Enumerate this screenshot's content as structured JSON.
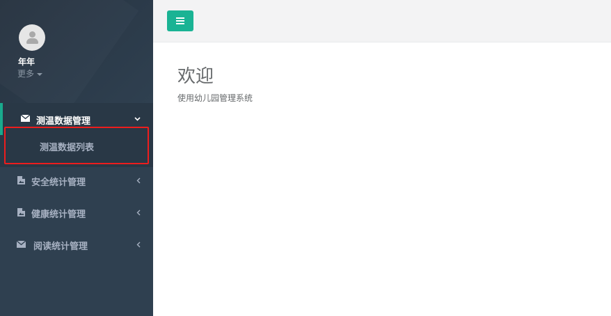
{
  "user": {
    "name": "年年",
    "more": "更多"
  },
  "nav": [
    {
      "label": "测温数据管理",
      "icon": "envelope-icon",
      "active": true,
      "expanded": true
    },
    {
      "label": "安全统计管理",
      "icon": "file-image-icon",
      "active": false,
      "expanded": false
    },
    {
      "label": "健康统计管理",
      "icon": "file-image-icon",
      "active": false,
      "expanded": false
    },
    {
      "label": "阅读统计管理",
      "icon": "envelope-icon",
      "active": false,
      "expanded": false
    }
  ],
  "submenu": [
    {
      "label": "测温数据列表"
    }
  ],
  "main": {
    "title": "欢迎",
    "subtitle": "使用幼儿园管理系统"
  },
  "colors": {
    "sidebar": "#2f4050",
    "accent": "#1ab394",
    "highlight_border": "#ee1d1d"
  }
}
